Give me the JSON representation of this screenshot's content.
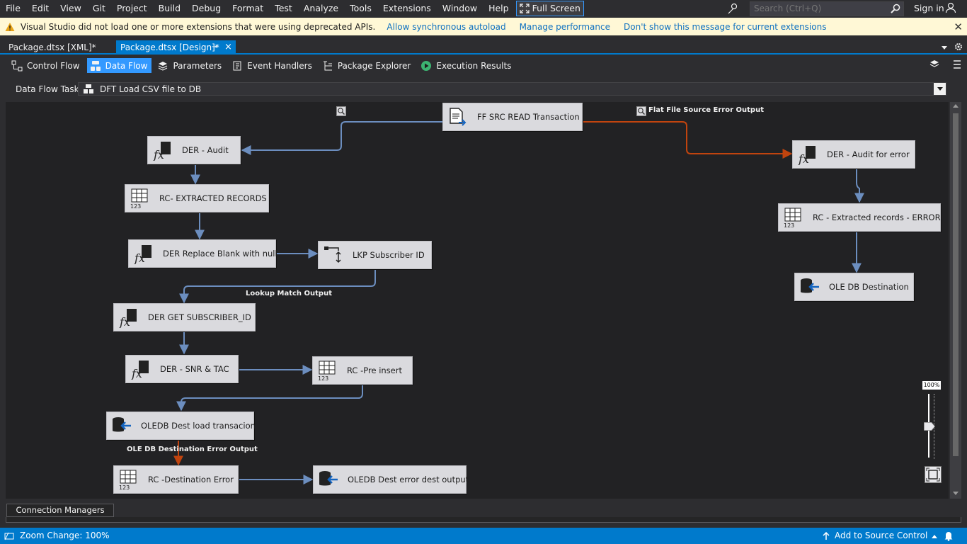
{
  "menu": [
    "File",
    "Edit",
    "View",
    "Git",
    "Project",
    "Build",
    "Debug",
    "Format",
    "Test",
    "Analyze",
    "Tools",
    "Extensions",
    "Window",
    "Help"
  ],
  "fullscreen_label": "Full Screen",
  "search": {
    "placeholder": "Search (Ctrl+Q)"
  },
  "signin": "Sign in",
  "infobar": {
    "message": "Visual Studio did not load one or more extensions that were using deprecated APIs.",
    "links": [
      "Allow synchronous autoload",
      "Manage performance",
      "Don't show this message for current extensions"
    ],
    "close": "✕"
  },
  "doc_tabs": {
    "xml": "Package.dtsx [XML]*",
    "design": "Package.dtsx [Design]*"
  },
  "designer_tabs": [
    "Control Flow",
    "Data Flow",
    "Parameters",
    "Event Handlers",
    "Package Explorer",
    "Execution Results"
  ],
  "task": {
    "label": "Data Flow Task:",
    "value": "DFT Load CSV file to DB"
  },
  "nodes": [
    {
      "id": "ff-src",
      "label": "FF SRC READ Transaction",
      "icon": "flat-file-source-icon"
    },
    {
      "id": "der-audit",
      "label": "DER - Audit",
      "icon": "derived-column-icon"
    },
    {
      "id": "rc-extracted",
      "label": "RC- EXTRACTED RECORDS",
      "icon": "row-count-icon"
    },
    {
      "id": "der-replace",
      "label": "DER Replace Blank with null",
      "icon": "derived-column-icon"
    },
    {
      "id": "lkp-sub",
      "label": "LKP Subscriber ID",
      "icon": "lookup-icon"
    },
    {
      "id": "der-get-sub",
      "label": "DER GET SUBSCRIBER_ID",
      "icon": "derived-column-icon"
    },
    {
      "id": "der-snr",
      "label": "DER - SNR & TAC",
      "icon": "derived-column-icon"
    },
    {
      "id": "rc-pre",
      "label": "RC -Pre insert",
      "icon": "row-count-icon"
    },
    {
      "id": "oledb-load",
      "label": "OLEDB Dest load transacion",
      "icon": "ole-db-destination-icon"
    },
    {
      "id": "rc-dest-err",
      "label": "RC -Destination Error",
      "icon": "row-count-icon"
    },
    {
      "id": "oledb-err",
      "label": "OLEDB Dest error dest output",
      "icon": "ole-db-destination-icon"
    },
    {
      "id": "der-audit-err",
      "label": "DER - Audit for error",
      "icon": "derived-column-icon"
    },
    {
      "id": "rc-err",
      "label": "RC - Extracted records  - ERROR",
      "icon": "row-count-icon"
    },
    {
      "id": "ole-dest",
      "label": "OLE DB Destination",
      "icon": "ole-db-destination-icon"
    }
  ],
  "connector_labels": {
    "flat_file_error": "Flat File Source Error Output",
    "lookup_match": "Lookup Match Output",
    "ole_error": "OLE DB Destination Error Output"
  },
  "colors": {
    "flow": "#6c8ebf",
    "error": "#c1440e",
    "accent": "#007acc",
    "infobar": "#fff8d6"
  },
  "zoom": {
    "label": "100%",
    "value": 100
  },
  "connection_managers": "Connection Managers",
  "status": {
    "text": "Zoom Change: 100%",
    "source_control": "Add to Source Control"
  }
}
